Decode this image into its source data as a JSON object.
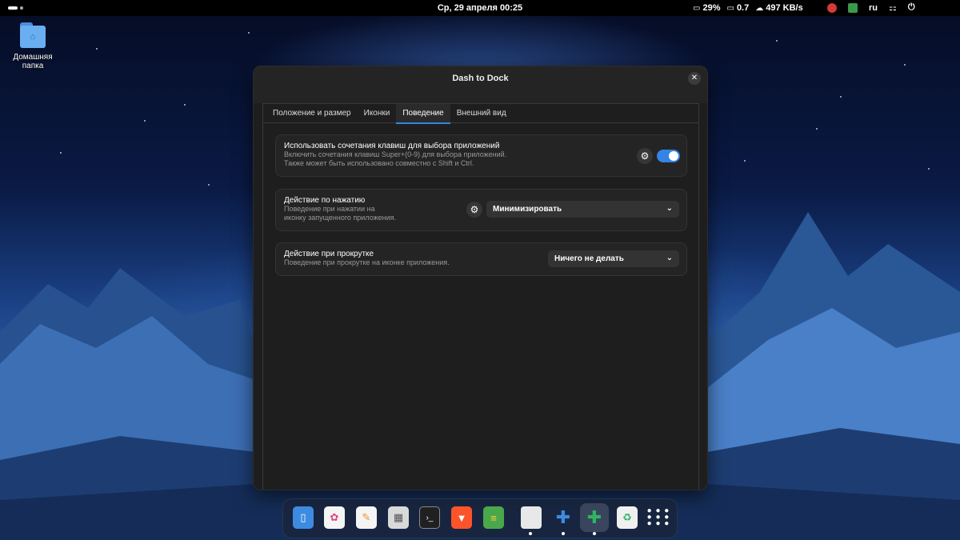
{
  "topbar": {
    "clock": "Ср, 29 апреля  00:25",
    "indicators": [
      {
        "icon": "battery-icon",
        "glyph": "▭",
        "text": "29%"
      },
      {
        "icon": "monitor-icon",
        "glyph": "▭",
        "text": "0.7"
      },
      {
        "icon": "cloud-download-icon",
        "glyph": "☁",
        "text": "497 KB/s"
      }
    ],
    "language": "ru"
  },
  "desktop": {
    "home_folder_label": "Домашняя папка"
  },
  "window": {
    "title": "Dash to Dock",
    "close_glyph": "✕",
    "tabs": [
      {
        "label": "Положение и размер",
        "active": false
      },
      {
        "label": "Иконки",
        "active": false
      },
      {
        "label": "Поведение",
        "active": true
      },
      {
        "label": "Внешний вид",
        "active": false
      }
    ],
    "settings": {
      "shortcuts": {
        "title": "Использовать сочетания клавиш для выбора приложений",
        "desc1": "Включить сочетания клавиш Super+(0-9) для выбора приложений.",
        "desc2": "Также может быть использовано совместно с Shift и Ctrl.",
        "enabled": true
      },
      "click_action": {
        "title": "Действие по нажатию",
        "desc1": "Поведение при нажатии на",
        "desc2": "иконку запущенного приложения.",
        "value": "Минимизировать"
      },
      "scroll_action": {
        "title": "Действие при прокрутке",
        "desc1": "Поведение при прокрутке на иконке приложения.",
        "value": "Ничего не делать"
      }
    }
  },
  "dock": {
    "items": [
      {
        "name": "files-app-icon",
        "glyph": "▯",
        "color": "#3d8be0",
        "running": false
      },
      {
        "name": "software-store-icon",
        "glyph": "✿",
        "color": "#f4f4f4",
        "running": false
      },
      {
        "name": "text-editor-icon",
        "glyph": "✎",
        "color": "#f5f5f5",
        "running": false
      },
      {
        "name": "calculator-icon",
        "glyph": "▦",
        "color": "#d9d9d9",
        "running": false
      },
      {
        "name": "terminal-icon",
        "glyph": "›_",
        "color": "#202020",
        "running": false
      },
      {
        "name": "brave-browser-icon",
        "glyph": "▼",
        "color": "#fb542b",
        "running": false
      },
      {
        "name": "layers-app-icon",
        "glyph": "≡",
        "color": "#4aa84a",
        "running": false
      },
      {
        "name": "disk-app-icon",
        "glyph": "●",
        "color": "#e8e8e8",
        "running": true
      },
      {
        "name": "extensions-icon",
        "glyph": "✚",
        "color": "#3d8be0",
        "running": true
      },
      {
        "name": "extension-manager-icon",
        "glyph": "✚",
        "color": "#2fb463",
        "running": true
      },
      {
        "name": "trash-recycle-icon",
        "glyph": "♻",
        "color": "#f0f0f0",
        "running": false
      },
      {
        "name": "app-grid-icon",
        "glyph": "⋮⋮⋮",
        "color": "#ffffff",
        "running": false
      }
    ]
  },
  "colors": {
    "accent": "#3584e4",
    "window_bg": "#1e1e1e",
    "card_bg": "#242424"
  }
}
